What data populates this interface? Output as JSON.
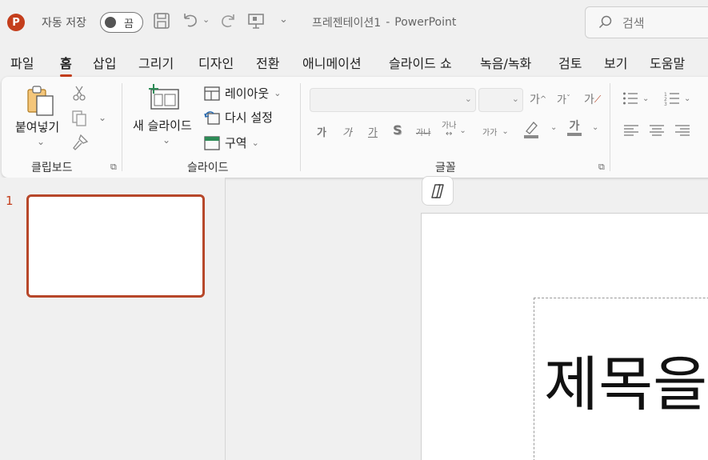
{
  "titlebar": {
    "app_logo_letter": "P",
    "autosave_label": "자동 저장",
    "autosave_state": "끔",
    "document_name": "프레젠테이션1",
    "separator": "-",
    "app_name": "PowerPoint",
    "search_placeholder": "검색"
  },
  "tabs": [
    {
      "label": "파일"
    },
    {
      "label": "홈"
    },
    {
      "label": "삽입"
    },
    {
      "label": "그리기"
    },
    {
      "label": "디자인"
    },
    {
      "label": "전환"
    },
    {
      "label": "애니메이션"
    },
    {
      "label": "슬라이드 쇼"
    },
    {
      "label": "녹음/녹화"
    },
    {
      "label": "검토"
    },
    {
      "label": "보기"
    },
    {
      "label": "도움말"
    }
  ],
  "ribbon": {
    "clipboard": {
      "label": "클립보드",
      "paste_label": "붙여넣기"
    },
    "slides": {
      "label": "슬라이드",
      "new_slide_label": "새 슬라이드",
      "layout_label": "레이아웃",
      "reset_label": "다시 설정",
      "section_label": "구역"
    },
    "font": {
      "label": "글꼴",
      "bold": "가",
      "italic": "가",
      "underline": "가",
      "shadow": "S",
      "strike": "가나",
      "spacing": "가나",
      "case": "가가",
      "grow": "가",
      "shrink": "가",
      "clear": "가",
      "font_color": "가"
    }
  },
  "slides_pane": {
    "slide_number": "1"
  },
  "canvas": {
    "title_text": "제목을"
  }
}
